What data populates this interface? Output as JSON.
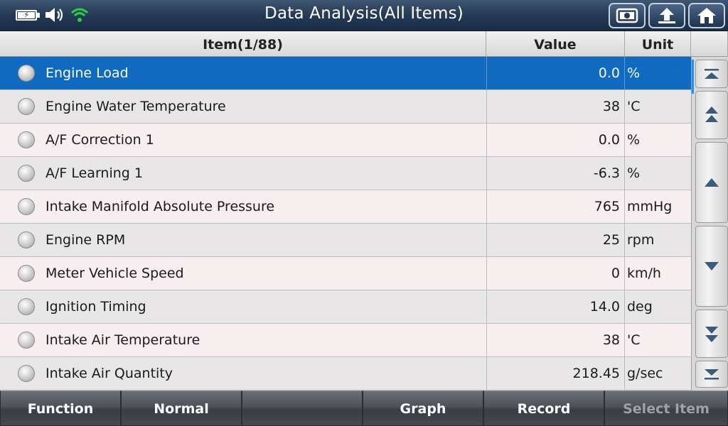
{
  "header": {
    "title": "Data Analysis(All Items)"
  },
  "status_icons": [
    "battery-charging-icon",
    "speaker-icon",
    "wifi-icon"
  ],
  "header_buttons": [
    "screenshot-icon",
    "back-icon",
    "home-icon"
  ],
  "table": {
    "col_item": "Item(1/88)",
    "col_value": "Value",
    "col_unit": "Unit",
    "rows": [
      {
        "name": "Engine Load",
        "value": "0.0",
        "unit": "%"
      },
      {
        "name": "Engine Water Temperature",
        "value": "38",
        "unit": "'C"
      },
      {
        "name": "A/F Correction 1",
        "value": "0.0",
        "unit": "%"
      },
      {
        "name": "A/F Learning 1",
        "value": "-6.3",
        "unit": "%"
      },
      {
        "name": "Intake Manifold Absolute Pressure",
        "value": "765",
        "unit": "mmHg"
      },
      {
        "name": "Engine RPM",
        "value": "25",
        "unit": "rpm"
      },
      {
        "name": "Meter Vehicle Speed",
        "value": "0",
        "unit": "km/h"
      },
      {
        "name": "Ignition Timing",
        "value": "14.0",
        "unit": "deg"
      },
      {
        "name": "Intake Air Temperature",
        "value": "38",
        "unit": "'C"
      },
      {
        "name": "Intake Air Quantity",
        "value": "218.45",
        "unit": "g/sec"
      }
    ]
  },
  "toolbar": {
    "function_label": "Function",
    "normal_label": "Normal",
    "empty_label": "",
    "graph_label": "Graph",
    "record_label": "Record",
    "select_item_label": "Select Item"
  },
  "colors": {
    "selected_row": "#0f6ac0",
    "title_bar": "#243a55",
    "wifi": "#2ecc40"
  }
}
